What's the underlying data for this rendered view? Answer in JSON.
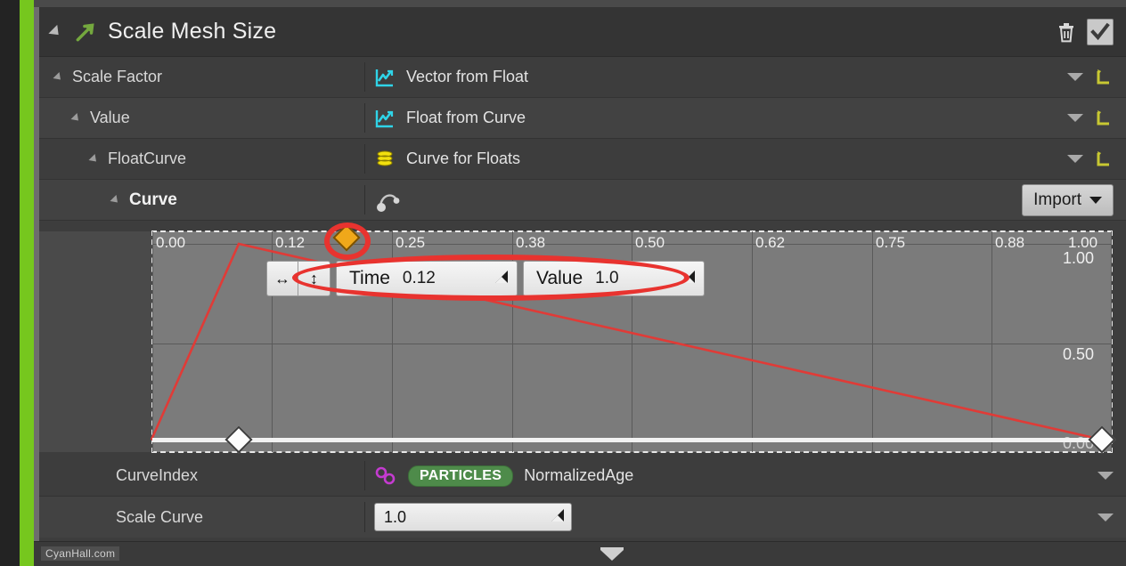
{
  "header": {
    "title": "Scale Mesh Size",
    "expand_icon": "collapse-triangle-icon",
    "module_icon": "green-arrow-icon",
    "delete_icon": "trash-icon",
    "enabled_checkbox": "checked-checkbox-icon"
  },
  "rows": [
    {
      "label": "Scale Factor",
      "value": "Vector from Float",
      "icon": "distribution-curve-icon",
      "dropdown": "chevron-down-icon",
      "reset": "reset-arrow-icon"
    },
    {
      "label": "Value",
      "value": "Float from Curve",
      "icon": "distribution-curve-icon",
      "dropdown": "chevron-down-icon",
      "reset": "reset-arrow-icon"
    },
    {
      "label": "FloatCurve",
      "value": "Curve for Floats",
      "icon": "database-stack-icon",
      "dropdown": "chevron-down-icon",
      "reset": "reset-arrow-icon"
    },
    {
      "label": "Curve",
      "value": "",
      "icon": "curve-nodes-icon",
      "button": "Import",
      "button_caret": "chevron-down-icon"
    }
  ],
  "curve_editor": {
    "popup": {
      "hmove_icon": "horizontal-resize-icon",
      "vmove_icon": "vertical-resize-icon",
      "time_label": "Time",
      "time_value": "0.12",
      "value_label": "Value",
      "value_value": "1.0",
      "drag_icon": "drag-corner-icon"
    },
    "curve_color": "#e03b37",
    "selected_key_color": "#f0a81a",
    "key_color": "#fdfdfd"
  },
  "chart_data": {
    "type": "line",
    "title": "",
    "xlabel": "",
    "ylabel": "",
    "xlim": [
      0.0,
      1.0
    ],
    "ylim": [
      0.0,
      1.0
    ],
    "grid": true,
    "legend": "none",
    "xticks": [
      "0.00",
      "0.12",
      "0.25",
      "0.38",
      "0.50",
      "0.62",
      "0.75",
      "0.88",
      "1.00"
    ],
    "xtick_values": [
      0.0,
      0.12,
      0.25,
      0.38,
      0.5,
      0.62,
      0.75,
      0.88,
      1.0
    ],
    "yticks_left": [
      "1.00",
      "0.50",
      "0.00"
    ],
    "yticks_right": [
      "1.00",
      "0.50",
      "0.00"
    ],
    "ytick_values": [
      1.0,
      0.5,
      0.0
    ],
    "series": [
      {
        "name": "FloatCurve",
        "color": "#e03b37",
        "points": [
          {
            "time": 0.0,
            "value": 0.0,
            "selected": false
          },
          {
            "time": 0.12,
            "value": 1.0,
            "selected": true
          },
          {
            "time": 1.0,
            "value": 0.0,
            "selected": false
          }
        ]
      }
    ]
  },
  "bottom_rows": [
    {
      "label": "CurveIndex",
      "link_icon": "link-chain-icon",
      "badge": "PARTICLES",
      "value": "NormalizedAge",
      "dropdown": "chevron-down-icon"
    },
    {
      "label": "Scale Curve",
      "value": "1.0",
      "drag_icon": "drag-corner-icon",
      "dropdown": "chevron-down-icon"
    }
  ],
  "footer": {
    "watermark": "CyanHall.com",
    "collapse_icon": "collapse-chevron-icon"
  },
  "colors": {
    "accent_green": "#76c71e",
    "panel_bg": "#3d3d3d",
    "header_bg": "#343434",
    "plot_bg": "#7b7b7b",
    "annotation_red": "#e8332f",
    "badge_green": "#4e8b4a",
    "reset_yellow": "#c8c832"
  }
}
